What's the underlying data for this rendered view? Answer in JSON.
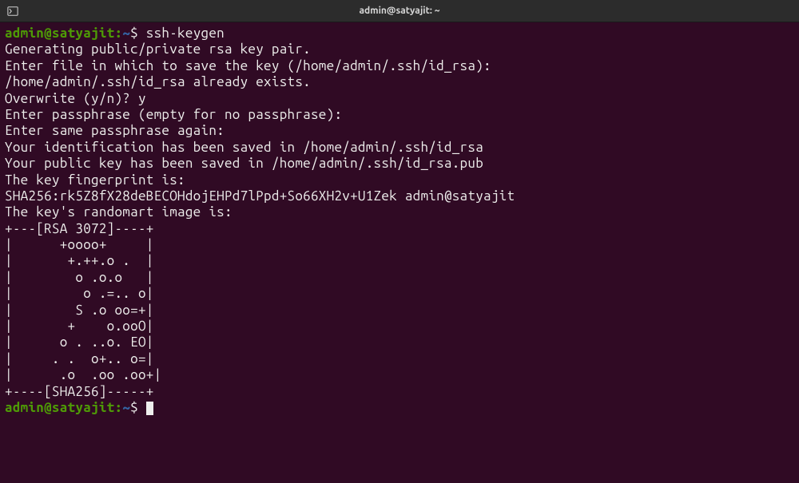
{
  "titlebar": {
    "title": "admin@satyajit: ~"
  },
  "prompt": {
    "user_host": "admin@satyajit",
    "colon": ":",
    "path": "~",
    "dollar": "$ "
  },
  "command1": "ssh-keygen",
  "output_lines": [
    "Generating public/private rsa key pair.",
    "Enter file in which to save the key (/home/admin/.ssh/id_rsa):",
    "/home/admin/.ssh/id_rsa already exists.",
    "Overwrite (y/n)? y",
    "Enter passphrase (empty for no passphrase):",
    "Enter same passphrase again:",
    "Your identification has been saved in /home/admin/.ssh/id_rsa",
    "Your public key has been saved in /home/admin/.ssh/id_rsa.pub",
    "The key fingerprint is:",
    "SHA256:rk5Z8fX28deBECOHdojEHPd7lPpd+So66XH2v+U1Zek admin@satyajit",
    "The key's randomart image is:",
    "+---[RSA 3072]----+",
    "|      +oooo+     |",
    "|       +.++.o .  |",
    "|        o .o.o   |",
    "|         o .=.. o|",
    "|        S .o oo=+|",
    "|       +    o.ooO|",
    "|      o . ..o. EO|",
    "|     . .  o+.. o=|",
    "|      .o  .oo .oo+|",
    "+----[SHA256]-----+"
  ]
}
